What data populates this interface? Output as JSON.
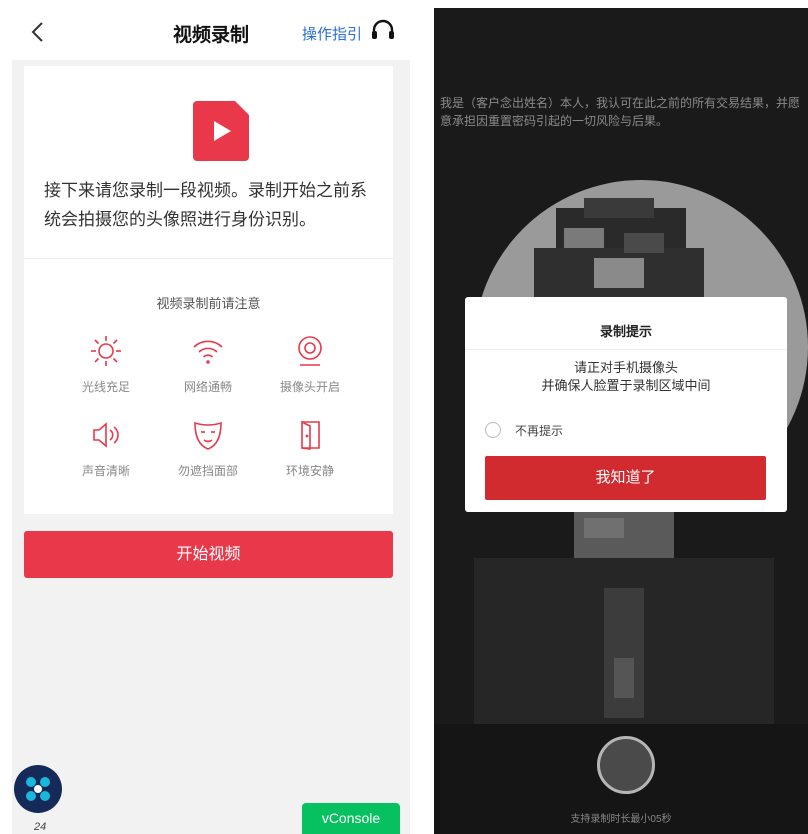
{
  "left": {
    "header": {
      "title": "视频录制",
      "guide_link": "操作指引"
    },
    "card": {
      "intro_line1": "接下来请您录制一段视频。录制开始之前系",
      "intro_line2": "统会拍摄您的头像照进行身份识别。",
      "notice_title": "视频录制前请注意",
      "conditions": [
        {
          "label": "光线充足",
          "icon": "sun-icon"
        },
        {
          "label": "网络通畅",
          "icon": "wifi-icon"
        },
        {
          "label": "摄像头开启",
          "icon": "camera-icon"
        },
        {
          "label": "声音清晰",
          "icon": "speaker-icon"
        },
        {
          "label": "勿遮挡面部",
          "icon": "face-mask-icon"
        },
        {
          "label": "环境安静",
          "icon": "door-icon"
        }
      ]
    },
    "start_button": "开始视频",
    "floating": {
      "logo_number": "24",
      "vconsole": "vConsole"
    }
  },
  "right": {
    "statement": "我是（客户念出姓名）本人，我认可在此之前的所有交易结果，并愿意承担因重置密码引起的一切风险与后果。",
    "dialog": {
      "title": "录制提示",
      "line1": "请正对手机摄像头",
      "line2": "并确保人脸置于录制区域中间",
      "checkbox_label": "不再提示",
      "confirm_button": "我知道了"
    },
    "record_hint": "支持录制时长最小05秒"
  },
  "colors": {
    "accent_red": "#e8384a",
    "dialog_red": "#d12b2f",
    "link_blue": "#2a6fd6",
    "vconsole_green": "#07c160"
  }
}
